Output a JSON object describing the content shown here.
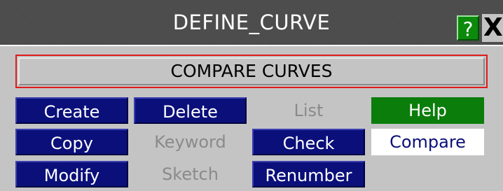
{
  "window": {
    "title": "DEFINE_CURVE",
    "help_glyph": "?",
    "close_glyph": "X"
  },
  "banner": {
    "label": "COMPARE CURVES"
  },
  "buttons": {
    "create": "Create",
    "delete": "Delete",
    "list": "List",
    "help": "Help",
    "copy": "Copy",
    "keyword": "Keyword",
    "check": "Check",
    "compare": "Compare",
    "modify": "Modify",
    "sketch": "Sketch",
    "renumber": "Renumber"
  },
  "colors": {
    "button_blue": "#0a0f7a",
    "button_green": "#0b7d0b",
    "banner_border": "#e11a1a",
    "titlebar": "#4b4b4b",
    "panel": "#c4c4c4"
  }
}
